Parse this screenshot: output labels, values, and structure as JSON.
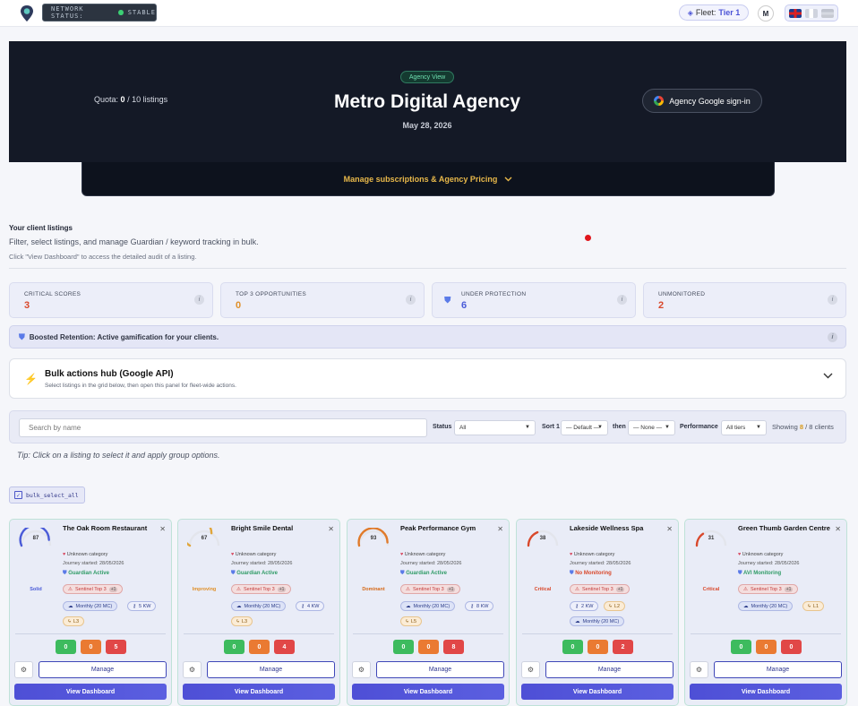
{
  "topbar": {
    "network_status_label": "NETWORK STATUS:",
    "network_status_value": "STABLE",
    "fleet_label": "Fleet:",
    "fleet_tier": "Tier 1",
    "avatar_initial": "M"
  },
  "hero": {
    "quota_label": "Quota:",
    "quota_value": "0",
    "quota_total": "/ 10 listings",
    "badge": "Agency View",
    "title": "Metro Digital Agency",
    "date": "May 28, 2026",
    "google_button": "Agency Google sign-in",
    "subscriptions": "Manage subscriptions & Agency Pricing"
  },
  "listings_header": {
    "title": "Your client listings",
    "subtitle": "Filter, select listings, and manage Guardian / keyword tracking in bulk.",
    "hint": "Click \"View Dashboard\" to access the detailed audit of a listing."
  },
  "stats": [
    {
      "label": "CRITICAL SCORES",
      "value": "3",
      "color": "#d9482b"
    },
    {
      "label": "TOP 3 OPPORTUNITIES",
      "value": "0",
      "color": "#e0902a"
    },
    {
      "label": "UNDER PROTECTION",
      "value": "6",
      "color": "#4a5bd8"
    },
    {
      "label": "UNMONITORED",
      "value": "2",
      "color": "#d9482b"
    }
  ],
  "retention_banner": "Boosted Retention: Active gamification for your clients.",
  "bulk_hub": {
    "title": "Bulk actions hub (Google API)",
    "desc": "Select listings in the grid below, then open this panel for fleet-wide actions."
  },
  "filters": {
    "search_placeholder": "Search by name",
    "status_label": "Status",
    "status_value": "All",
    "sort_label": "Sort 1",
    "sort_value": "— Default —",
    "then_label": "then",
    "then_value": "— None —",
    "performance_label": "Performance",
    "performance_value": "All tiers",
    "showing_prefix": "Showing",
    "showing_value": "8",
    "showing_suffix": "/ 8 clients"
  },
  "tip": "Tip: Click on a listing to select it and apply group options.",
  "bulk_select_label": "bulk_select_all",
  "cards": [
    {
      "score": "87",
      "score_color": "#4a5bd8",
      "status": "Solid",
      "status_color": "#4a5bd8",
      "name": "The Oak Room Restaurant",
      "category": "Unknown category",
      "journey": "Journey started: 28/05/2026",
      "guardian": "Guardian Active",
      "guardian_color": "#2f9b66",
      "sentinel": "Sentinel Top 3",
      "sentinel_extra": "+1",
      "monthly": "Monthly (20 MC)",
      "kw": "5 KW",
      "level": "L3",
      "scores": [
        "0",
        "0",
        "5"
      ],
      "manage": "Manage",
      "view": "View Dashboard"
    },
    {
      "score": "67",
      "score_color": "#e0a53a",
      "status": "Improving",
      "status_color": "#e0902a",
      "name": "Bright Smile Dental",
      "category": "Unknown category",
      "journey": "Journey started: 28/05/2026",
      "guardian": "Guardian Active",
      "guardian_color": "#2f9b66",
      "sentinel": "Sentinel Top 3",
      "sentinel_extra": "+1",
      "monthly": "Monthly (20 MC)",
      "kw": "4 KW",
      "level": "L3",
      "scores": [
        "0",
        "0",
        "4"
      ],
      "manage": "Manage",
      "view": "View Dashboard"
    },
    {
      "score": "93",
      "score_color": "#e07a2a",
      "status": "Dominant",
      "status_color": "#d66a1a",
      "name": "Peak Performance Gym",
      "category": "Unknown category",
      "journey": "Journey started: 28/05/2026",
      "guardian": "Guardian Active",
      "guardian_color": "#2f9b66",
      "sentinel": "Sentinel Top 3",
      "sentinel_extra": "+1",
      "monthly": "Monthly (20 MC)",
      "kw": "8 KW",
      "level": "L5",
      "scores": [
        "0",
        "0",
        "8"
      ],
      "manage": "Manage",
      "view": "View Dashboard"
    },
    {
      "score": "38",
      "score_color": "#d9482b",
      "status": "Critical",
      "status_color": "#d9482b",
      "name": "Lakeside Wellness Spa",
      "category": "Unknown category",
      "journey": "Journey started: 28/05/2026",
      "guardian": "No Monitoring",
      "guardian_color": "#d9482b",
      "sentinel": "Sentinel Top 3",
      "sentinel_extra": "+1",
      "kw": "2 KW",
      "level": "L2",
      "monthly": "Monthly (20 MC)",
      "scores": [
        "0",
        "0",
        "2"
      ],
      "manage": "Manage",
      "view": "View Dashboard"
    },
    {
      "score": "31",
      "score_color": "#d9482b",
      "status": "Critical",
      "status_color": "#d9482b",
      "name": "Green Thumb Garden Centre",
      "category": "Unknown category",
      "journey": "Journey started: 28/05/2026",
      "guardian": "AVI Monitoring",
      "guardian_color": "#2f9b66",
      "sentinel": "Sentinel Top 3",
      "sentinel_extra": "+1",
      "monthly": "Monthly (20 MC)",
      "level": "L1",
      "scores": [
        "0",
        "0",
        "0"
      ],
      "manage": "Manage",
      "view": "View Dashboard"
    }
  ]
}
